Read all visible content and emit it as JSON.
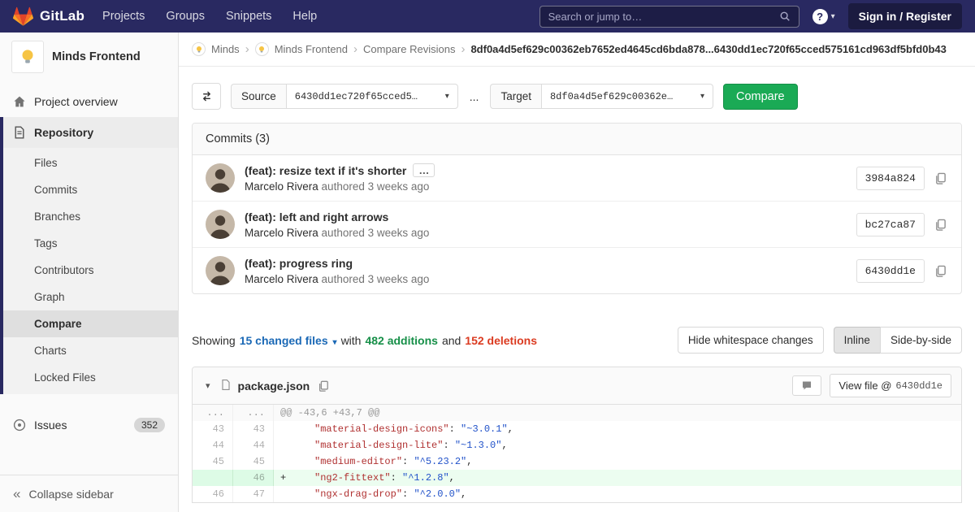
{
  "icons": {
    "chevron_down": "▾",
    "breadcrumb_sep": "›",
    "ellipsis": "…",
    "collapse": "«",
    "help": "?"
  },
  "navbar": {
    "brand": "GitLab",
    "menu": [
      "Projects",
      "Groups",
      "Snippets",
      "Help"
    ],
    "search_placeholder": "Search or jump to…",
    "sign_in_label": "Sign in / Register"
  },
  "sidebar": {
    "project_name": "Minds Frontend",
    "overview_label": "Project overview",
    "repository_label": "Repository",
    "repo_subitems": [
      "Files",
      "Commits",
      "Branches",
      "Tags",
      "Contributors",
      "Graph",
      "Compare",
      "Charts",
      "Locked Files"
    ],
    "issues_label": "Issues",
    "issues_count": "352",
    "collapse_label": "Collapse sidebar"
  },
  "breadcrumb": {
    "group": "Minds",
    "project": "Minds Frontend",
    "page": "Compare Revisions",
    "sha_range": "8df0a4d5ef629c00362eb7652ed4645cd6bda878...6430dd1ec720f65cced575161cd963df5bfd0b43"
  },
  "compare_form": {
    "source_label": "Source",
    "source_value": "6430dd1ec720f65cced5…",
    "separator": "...",
    "target_label": "Target",
    "target_value": "8df0a4d5ef629c00362e…",
    "compare_button": "Compare"
  },
  "commits": {
    "title": "Commits (3)",
    "items": [
      {
        "message": "(feat): resize text if it's shorter",
        "author": "Marcelo Rivera",
        "meta": "authored 3 weeks ago",
        "sha": "3984a824"
      },
      {
        "message": "(feat): left and right arrows",
        "author": "Marcelo Rivera",
        "meta": "authored 3 weeks ago",
        "sha": "bc27ca87"
      },
      {
        "message": "(feat): progress ring",
        "author": "Marcelo Rivera",
        "meta": "authored 3 weeks ago",
        "sha": "6430dd1e"
      }
    ]
  },
  "diff_summary": {
    "showing": "Showing",
    "changed_files": "15 changed files",
    "with": "with",
    "additions": "482 additions",
    "and": "and",
    "deletions": "152 deletions",
    "hide_whitespace": "Hide whitespace changes",
    "inline": "Inline",
    "side_by_side": "Side-by-side"
  },
  "diff_file": {
    "filename": "package.json",
    "view_file_label": "View file @",
    "view_file_sha": "6430dd1e",
    "hunk": {
      "old": "...",
      "new": "...",
      "text": "@@ -43,6 +43,7 @@"
    },
    "sep": ": ",
    "comma": ",",
    "lines": [
      {
        "old": "43",
        "new": "43",
        "sign": "",
        "key": "\"material-design-icons\"",
        "value": "\"~3.0.1\""
      },
      {
        "old": "44",
        "new": "44",
        "sign": "",
        "key": "\"material-design-lite\"",
        "value": "\"~1.3.0\""
      },
      {
        "old": "45",
        "new": "45",
        "sign": "",
        "key": "\"medium-editor\"",
        "value": "\"^5.23.2\""
      },
      {
        "old": "",
        "new": "46",
        "sign": "+",
        "key": "\"ng2-fittext\"",
        "value": "\"^1.2.8\""
      },
      {
        "old": "46",
        "new": "47",
        "sign": "",
        "key": "\"ngx-drag-drop\"",
        "value": "\"^2.0.0\""
      }
    ]
  },
  "colors": {
    "navbar_bg": "#292961",
    "button_green": "#1aaa55",
    "additions_green": "#168f48",
    "deletions_red": "#db3b21",
    "link_blue": "#1b69b6"
  }
}
